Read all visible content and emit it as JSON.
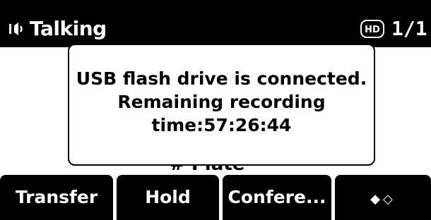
{
  "status_bar": {
    "icon": "speaker-icon",
    "label": "Talking",
    "hd_label": "HD",
    "call_count": "1/1"
  },
  "background": {
    "partial_text": "# Plate"
  },
  "popup": {
    "line1": "USB flash drive is connected.",
    "line2": "Remaining recording",
    "line3": "time:57:26:44"
  },
  "softkeys": [
    {
      "label": "Transfer"
    },
    {
      "label": "Hold"
    },
    {
      "label": "Confere..."
    },
    {
      "label": "◆◇"
    }
  ],
  "colors": {
    "background": "#ffffff",
    "bar": "#000000",
    "text_light": "#ffffff",
    "text_dark": "#000000"
  }
}
